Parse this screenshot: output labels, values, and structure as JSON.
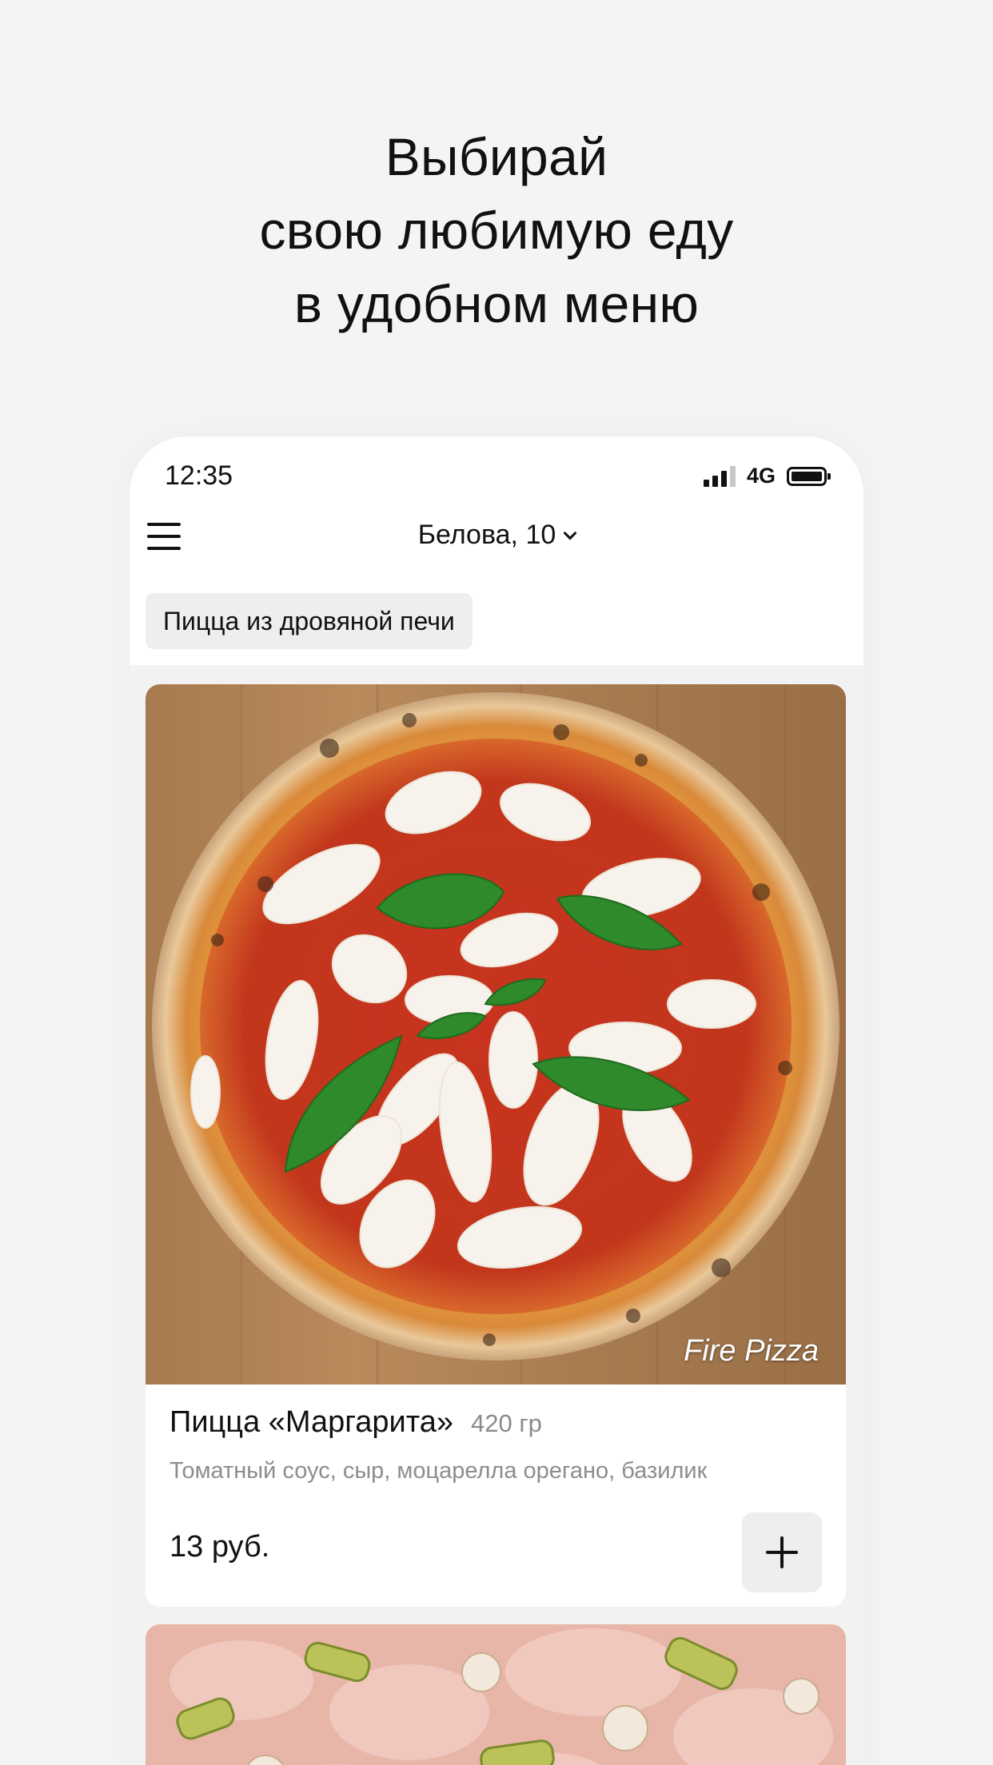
{
  "promo": {
    "headline_lines": [
      "Выбирай",
      "свою любимую еду",
      "в удобном меню"
    ]
  },
  "statusbar": {
    "time": "12:35",
    "network": "4G",
    "signal_bars_active": 3,
    "signal_bars_total": 4
  },
  "header": {
    "menu_icon": "hamburger-menu-icon",
    "location": "Белова, 10",
    "location_icon": "chevron-down-icon"
  },
  "categories": [
    {
      "label": "Пицца из дровяной печи",
      "active": true
    }
  ],
  "products": [
    {
      "title": "Пицца «Маргарита»",
      "weight": "420 гр",
      "description": "Томатный соус, сыр, моцарелла орегано, базилик",
      "price": "13 руб.",
      "image_watermark": "Fire Pizza",
      "add_icon": "plus-icon"
    }
  ],
  "colors": {
    "background": "#f4f4f4",
    "surface": "#ffffff",
    "chip": "#eeeeee",
    "text_primary": "#111111",
    "text_secondary": "#8a8a8a"
  }
}
